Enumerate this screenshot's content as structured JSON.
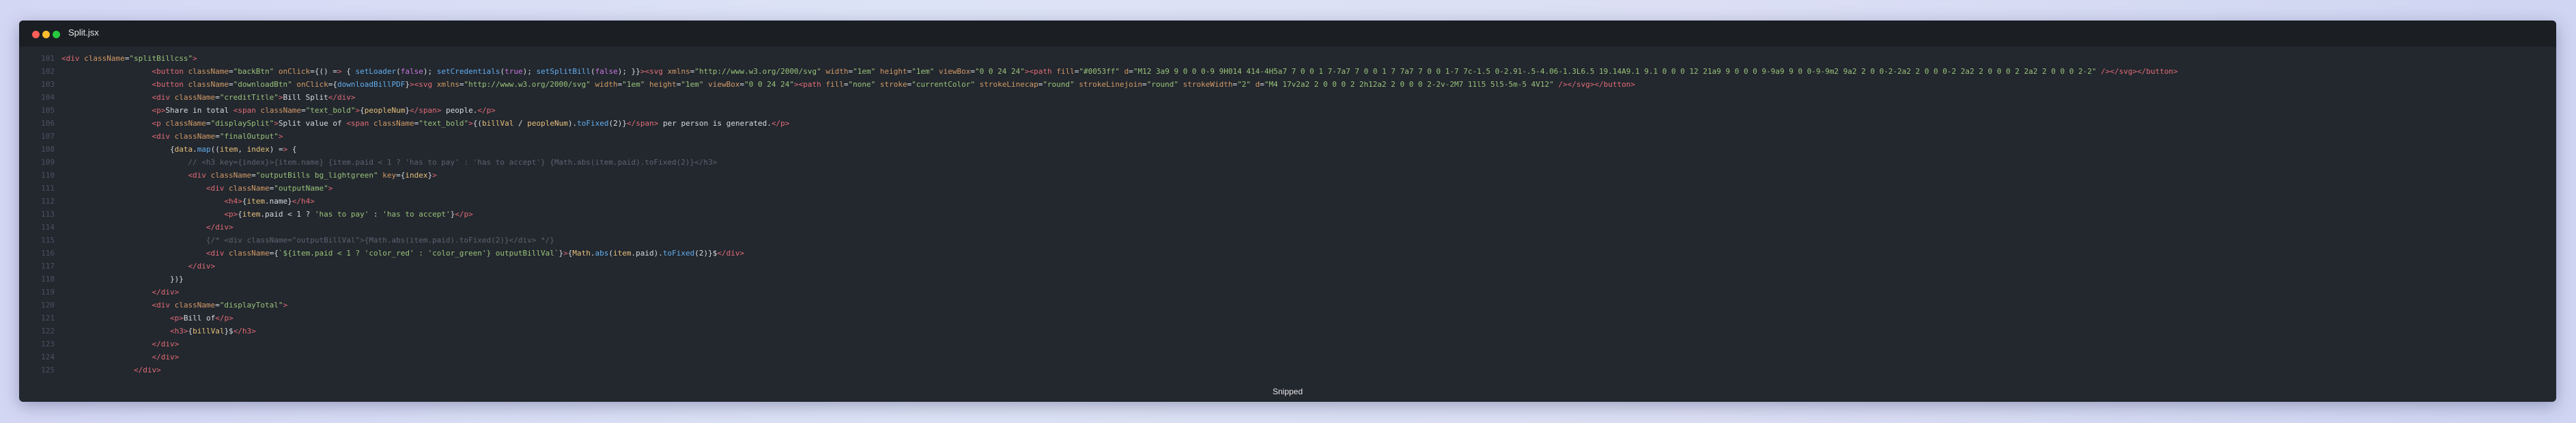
{
  "window": {
    "title": "Split.jsx",
    "footer": "Snipped"
  },
  "colors": {
    "bg": "#23272e",
    "titlebar": "#1b1e23",
    "tag": "#e06c75",
    "attr": "#d19a66",
    "string": "#98c379",
    "keyword": "#c678dd",
    "fn": "#61afef",
    "var": "#e5c07b",
    "text": "#abb2bf",
    "comment": "#5c6370",
    "lineno": "#4b5263"
  },
  "code": [
    {
      "n": "101",
      "t": "<div className=\"splitBillcss\">"
    },
    {
      "n": "102",
      "t": "                    <button className=\"backBtn\" onClick={() => { setLoader(false); setCredentials(true); setSplitBill(false); }}><svg xmlns=\"http://www.w3.org/2000/svg\" width=\"1em\" height=\"1em\" viewBox=\"0 0 24 24\"><path fill=\"#0053ff\" d=\"M12 3a9 9 0 0 0-9 9H014 414-4H5a7 7 0 0 1 7-7a7 7 0 0 1 7 7a7 7 0 0 1-7 7c-1.5 0-2.91-.5-4.06-1.3L6.5 19.14A9.1 9.1 0 0 0 12 21a9 9 0 0 0 9-9a9 9 0 0-9-9m2 9a2 2 0 0-2-2a2 2 0 0 0-2 2a2 2 0 0 0 2 2a2 2 0 0 0 2-2\" /></svg></button>"
    },
    {
      "n": "103",
      "t": "                    <button className=\"downloadBtn\" onClick={downloadBillPDF}><svg xmlns=\"http://www.w3.org/2000/svg\" width=\"1em\" height=\"1em\" viewBox=\"0 0 24 24\"><path fill=\"none\" stroke=\"currentColor\" strokeLinecap=\"round\" strokeLinejoin=\"round\" strokeWidth=\"2\" d=\"M4 17v2a2 2 0 0 0 2 2h12a2 2 0 0 0 2-2v-2M7 11l5 5l5-5m-5 4V12\" /></svg></button>"
    },
    {
      "n": "104",
      "t": "                    <div className=\"creditTitle\">Bill Split</div>"
    },
    {
      "n": "105",
      "t": "                    <p>Share in total <span className=\"text_bold\">{peopleNum}</span> people.</p>"
    },
    {
      "n": "106",
      "t": "                    <p className=\"displaySplit\">Split value of <span className=\"text_bold\">{(billVal / peopleNum).toFixed(2)}</span> per person is generated.</p>"
    },
    {
      "n": "107",
      "t": "                    <div className=\"finalOutput\">"
    },
    {
      "n": "108",
      "t": "                        {data.map((item, index) => {"
    },
    {
      "n": "109",
      "t": "                            // <h3 key={index}>{item.name} {item.paid < 1 ? 'has to pay' : 'has to accept'} {Math.abs(item.paid).toFixed(2)}</h3>"
    },
    {
      "n": "110",
      "t": "                            <div className=\"outputBills bg_lightgreen\" key={index}>"
    },
    {
      "n": "111",
      "t": "                                <div className=\"outputName\">"
    },
    {
      "n": "112",
      "t": "                                    <h4>{item.name}</h4>"
    },
    {
      "n": "113",
      "t": "                                    <p>{item.paid < 1 ? 'has to pay' : 'has to accept'}</p>"
    },
    {
      "n": "114",
      "t": "                                </div>"
    },
    {
      "n": "115",
      "t": "                                {/* <div className=\"outputBillVal\">{Math.abs(item.paid).toFixed(2)}</div> */}"
    },
    {
      "n": "116",
      "t": "                                <div className={`${item.paid < 1 ? 'color_red' : 'color_green'} outputBillVal`}>{Math.abs(item.paid).toFixed(2)}$</div>"
    },
    {
      "n": "117",
      "t": "                            </div>"
    },
    {
      "n": "118",
      "t": "                        })}"
    },
    {
      "n": "119",
      "t": "                    </div>"
    },
    {
      "n": "120",
      "t": "                    <div className=\"displayTotal\">"
    },
    {
      "n": "121",
      "t": "                        <p>Bill of</p>"
    },
    {
      "n": "122",
      "t": "                        <h3>{billVal}$</h3>"
    },
    {
      "n": "123",
      "t": "                    </div>"
    },
    {
      "n": "124",
      "t": "                    </div>"
    },
    {
      "n": "125",
      "t": "                </div>"
    }
  ]
}
